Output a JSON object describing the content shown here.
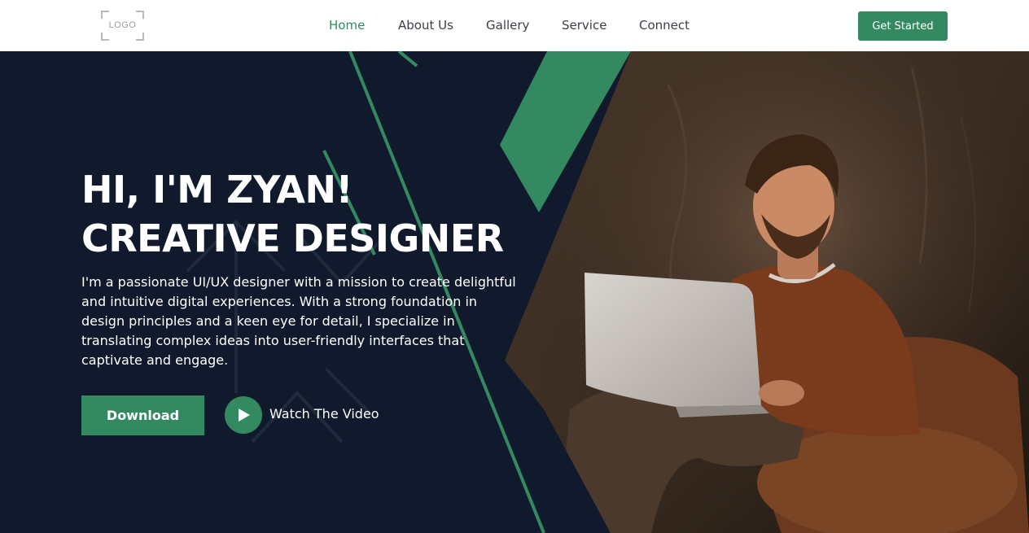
{
  "header": {
    "logo_text": "LOGO",
    "nav": [
      {
        "label": "Home",
        "active": true
      },
      {
        "label": "About Us",
        "active": false
      },
      {
        "label": "Gallery",
        "active": false
      },
      {
        "label": "Service",
        "active": false
      },
      {
        "label": "Connect",
        "active": false
      }
    ],
    "cta_label": "Get Started"
  },
  "hero": {
    "title_line1": "HI, I'M ZYAN!",
    "title_line2": "CREATIVE DESIGNER",
    "description": "I'm a passionate UI/UX designer with a mission to create delightful and intuitive digital experiences. With a strong foundation in design principles and a keen eye for detail, I specialize in translating complex ideas into user-friendly interfaces that captivate and engage.",
    "download_label": "Download",
    "video_label": "Watch The Video"
  },
  "icons": {
    "play": "play-icon",
    "logo": "logo-placeholder-icon"
  },
  "colors": {
    "accent": "#338a61",
    "active_nav": "#2e8b5f",
    "hero_bg": "#111a2c",
    "header_bg": "#ffffff",
    "text_dark": "#3a3f48"
  }
}
